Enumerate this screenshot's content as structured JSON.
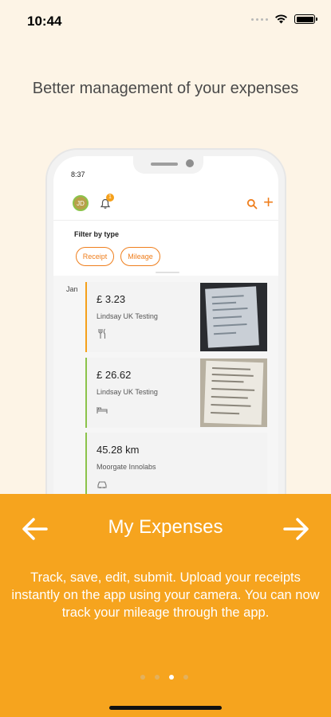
{
  "status_bar": {
    "time": "10:44",
    "signal_icon": "cellular-dots-icon",
    "wifi_icon": "wifi-icon",
    "battery_icon": "battery-icon"
  },
  "headline": "Better management of your expenses",
  "phone": {
    "time": "8:37",
    "avatar_initials": "JD",
    "notification_count": "1",
    "filter_label": "Filter by type",
    "chips": [
      "Receipt",
      "Mileage"
    ],
    "month": "Jan",
    "expenses": [
      {
        "amount": "£ 3.23",
        "merchant": "Lindsay UK Testing",
        "category_icon": "fork-knife-icon",
        "accent": "#f5a01a"
      },
      {
        "amount": "£ 26.62",
        "merchant": "Lindsay UK Testing",
        "category_icon": "bed-icon",
        "accent": "#8bc34a"
      },
      {
        "amount": "45.28 km",
        "merchant": "Moorgate Innolabs",
        "category_icon": "car-icon",
        "accent": "#8bc34a"
      }
    ]
  },
  "panel": {
    "title": "My Expenses",
    "text": "Track, save, edit, submit. Upload your receipts instantly on the app using your camera. You can now track your mileage through the app.",
    "page_count": 4,
    "active_page": 3,
    "background": "#f6a41e"
  },
  "colors": {
    "accent": "#ef7e1c",
    "background": "#fdf4e6"
  }
}
